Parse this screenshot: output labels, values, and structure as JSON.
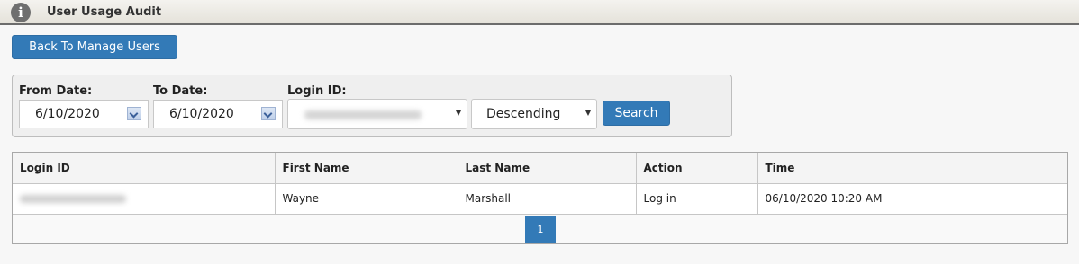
{
  "header": {
    "icon": "info-icon",
    "title": "User Usage Audit"
  },
  "back_button": "Back To Manage Users",
  "filters": {
    "from_date_label": "From Date:",
    "from_date_value": "6/10/2020",
    "to_date_label": "To Date:",
    "to_date_value": "6/10/2020",
    "login_id_label": "Login ID:",
    "login_id_value": "",
    "sort_value": "Descending",
    "search_label": "Search"
  },
  "table": {
    "columns": [
      "Login ID",
      "First Name",
      "Last Name",
      "Action",
      "Time"
    ],
    "rows": [
      {
        "login_id": "",
        "first_name": "Wayne",
        "last_name": "Marshall",
        "action": "Log in",
        "time": "06/10/2020 10:20 AM"
      }
    ]
  },
  "pagination": {
    "current_page": "1"
  },
  "colors": {
    "primary_button": "#337ab7"
  }
}
